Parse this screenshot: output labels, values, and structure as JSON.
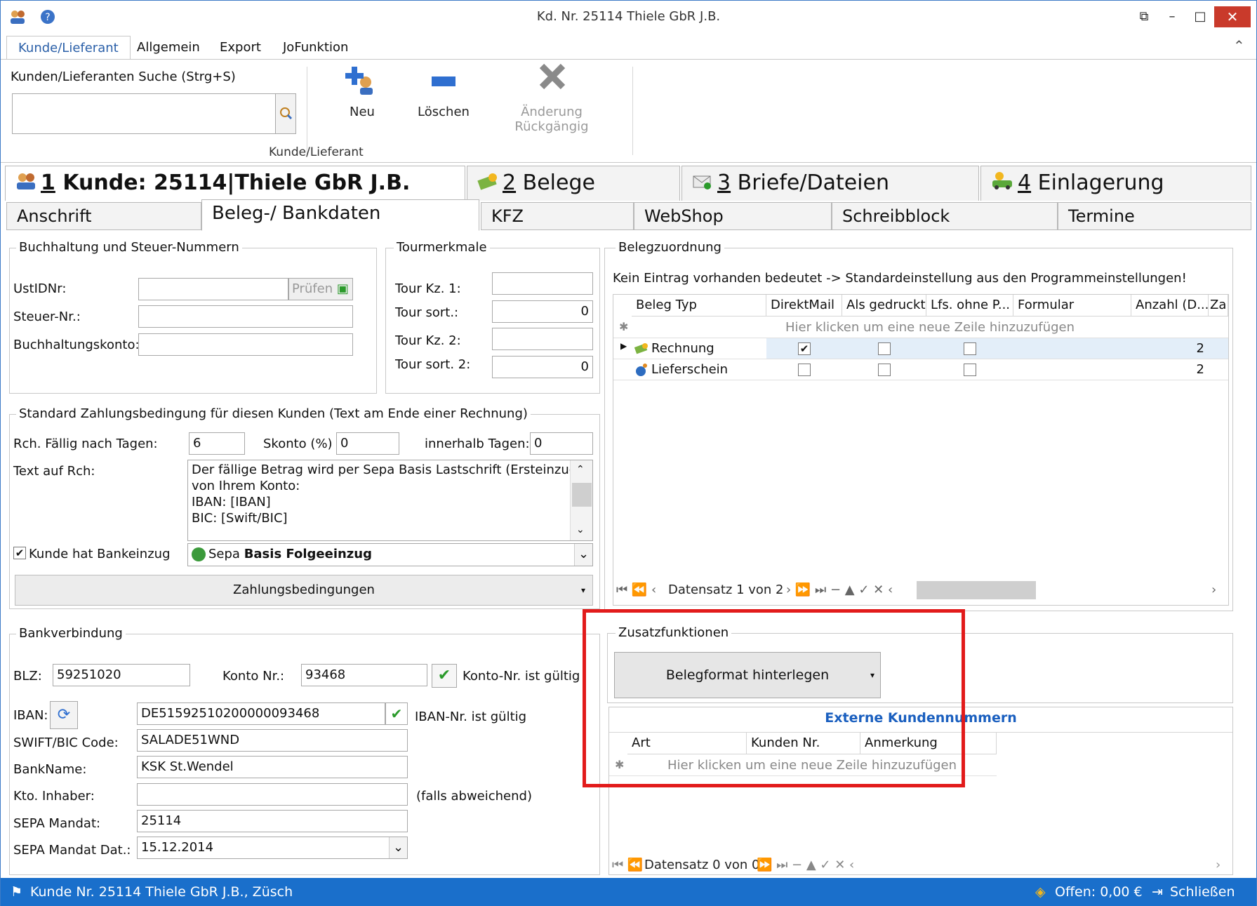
{
  "window": {
    "title": "Kd. Nr. 25114 Thiele GbR J.B.",
    "close": "✕",
    "minimize": "–",
    "maximize": "□",
    "restore": "⧉"
  },
  "ribbon": {
    "tabs": [
      "Kunde/Lieferant",
      "Allgemein",
      "Export",
      "JoFunktion"
    ],
    "search_label": "Kunden/Lieferanten Suche (Strg+S)",
    "search_value": "",
    "btn_neu": "Neu",
    "btn_loeschen": "Löschen",
    "btn_undo": "Änderung Rückgängig",
    "group_label": "Kunde/Lieferant"
  },
  "main_tabs": [
    {
      "num": "1",
      "label": " Kunde: 25114|Thiele GbR J.B."
    },
    {
      "num": "2",
      "label": " Belege"
    },
    {
      "num": "3",
      "label": " Briefe/Dateien"
    },
    {
      "num": "4",
      "label": " Einlagerung"
    }
  ],
  "sub_tabs": [
    "Anschrift",
    "Beleg-/ Bankdaten",
    "KFZ",
    "WebShop",
    "Schreibblock",
    "Termine"
  ],
  "buchhaltung": {
    "title": "Buchhaltung und Steuer-Nummern",
    "ust_label": "UstIDNr:",
    "pruefen": "Prüfen",
    "steuer_label": "Steuer-Nr.:",
    "konto_label": "Buchhaltungskonto:"
  },
  "tour": {
    "title": "Tourmerkmale",
    "kz1_label": "Tour Kz. 1:",
    "sort1_label": "Tour sort.:",
    "sort1_value": "0",
    "kz2_label": "Tour Kz. 2:",
    "sort2_label": "Tour sort. 2:",
    "sort2_value": "0"
  },
  "zahlung": {
    "title": "Standard Zahlungsbedingung für diesen Kunden (Text am Ende einer Rechnung)",
    "faellig_label": "Rch. Fällig nach Tagen:",
    "faellig_value": "6",
    "skonto_label": "Skonto (%)",
    "skonto_value": "0",
    "innerhalb_label": "innerhalb Tagen:",
    "innerhalb_value": "0",
    "text_label": "Text auf Rch:",
    "text_lines": [
      "Der fällige Betrag wird per Sepa Basis Lastschrift (Ersteinzug)",
      "von Ihrem Konto:",
      "IBAN: [IBAN]",
      "BIC: [Swift/BIC]"
    ],
    "bankeinzug_label": "Kunde hat Bankeinzug",
    "sepa_prefix": "Sepa ",
    "sepa_bold": "Basis Folgeeinzug",
    "zahlungsbedingungen": "Zahlungsbedingungen"
  },
  "beleg": {
    "title": "Belegzuordnung",
    "info": "Kein Eintrag vorhanden bedeutet -> Standardeinstellung aus den Programmeinstellungen!",
    "columns": [
      "Beleg Typ",
      "DirektMail",
      "Als gedruckt",
      "Lfs. ohne P...",
      "Formular",
      "Anzahl (D...",
      "Za"
    ],
    "new_row": "Hier klicken um eine neue Zeile hinzuzufügen",
    "rows": [
      {
        "typ": "Rechnung",
        "direktmail": true,
        "gedruckt": false,
        "lfs": false,
        "anzahl": "2"
      },
      {
        "typ": "Lieferschein",
        "direktmail": false,
        "gedruckt": false,
        "lfs": false,
        "anzahl": "2"
      }
    ],
    "nav": "Datensatz 1 von 2"
  },
  "bank": {
    "title": "Bankverbindung",
    "blz_label": "BLZ:",
    "blz_value": "59251020",
    "konto_label": "Konto Nr.:",
    "konto_value": "93468",
    "konto_ok": "Konto-Nr. ist gültig",
    "iban_label": "IBAN:",
    "iban_value": "DE51592510200000093468",
    "iban_ok": "IBAN-Nr. ist gültig",
    "swift_label": "SWIFT/BIC Code:",
    "swift_value": "SALADE51WND",
    "bankname_label": "BankName:",
    "bankname_value": "KSK St.Wendel",
    "inhaber_label": "Kto. Inhaber:",
    "inhaber_value": "",
    "inhaber_note": "(falls abweichend)",
    "mandat_label": "SEPA Mandat:",
    "mandat_value": "25114",
    "mandatdat_label": "SEPA Mandat Dat.:",
    "mandatdat_value": "15.12.2014"
  },
  "zusatz": {
    "title": "Zusatzfunktionen",
    "button": "Belegformat hinterlegen",
    "ext_title": "Externe Kundennummern",
    "columns": [
      "Art",
      "Kunden Nr.",
      "Anmerkung"
    ],
    "new_row": "Hier klicken um eine neue Zeile hinzuzufügen",
    "nav": "Datensatz 0 von 0"
  },
  "status": {
    "left": "Kunde Nr. 25114 Thiele GbR J.B., Züsch",
    "offen": "Offen: 0,00 €",
    "schliessen": "Schließen"
  },
  "colors": {
    "accent": "#1a6fcb",
    "highlight": "#e21b1b",
    "ok": "#2a9a2a"
  }
}
